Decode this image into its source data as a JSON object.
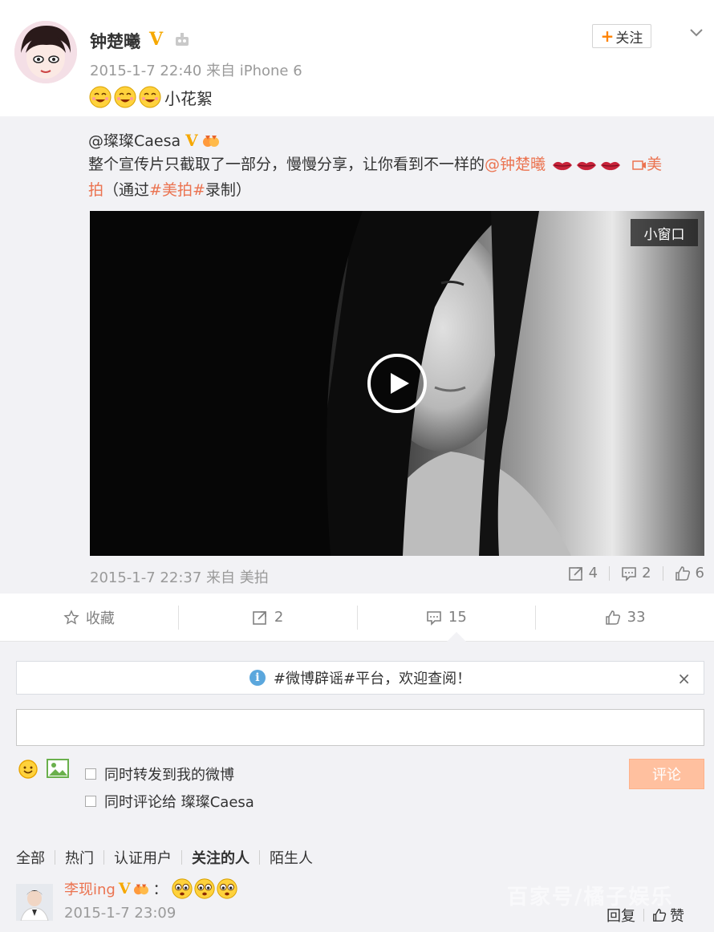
{
  "post": {
    "author": "钟楚曦",
    "meta": "2015-1-7 22:40 来自 iPhone 6",
    "text": "小花絮",
    "emoji_count": 3,
    "follow_label": "关注",
    "follow_plus": "+"
  },
  "repost": {
    "author": "@璨璨Caesa",
    "text_pre": "整个宣传片只截取了一部分，慢慢分享，让你看到不一样的",
    "text_mention": "@钟楚曦",
    "text_link1": "美",
    "text_link2": "拍",
    "text_via_pre": "（通过",
    "text_topic": "#美拍#",
    "text_via_post": "录制）",
    "mini_window": "小窗口",
    "meta": "2015-1-7 22:37 来自 美拍",
    "forwards": "4",
    "comments": "2",
    "likes": "6"
  },
  "action_bar": {
    "favorite": "收藏",
    "forward": "2",
    "comment": "15",
    "like": "33"
  },
  "comment_box": {
    "notice": "#微博辟谣#平台，欢迎查阅！",
    "close": "×",
    "input_value": "",
    "check1": "同时转发到我的微博",
    "check2": "同时评论给 璨璨Caesa",
    "submit": "评论"
  },
  "filters": [
    "全部",
    "热门",
    "认证用户",
    "关注的人",
    "陌生人"
  ],
  "comment": {
    "user": "李现ing",
    "colon": "：",
    "meta": "2015-1-7 23:09",
    "reply": "回复",
    "like": "赞"
  },
  "watermark": "百家号/橘子娱乐",
  "colors": {
    "accent": "#eb7350",
    "vip": "#f6a800",
    "repost_bg": "#f2f2f5"
  },
  "icons": [
    "robot-icon",
    "chevron-down-icon",
    "lips-icon",
    "video-link-icon",
    "play-icon",
    "forward-icon",
    "comment-icon",
    "like-icon",
    "star-icon",
    "info-icon",
    "smile-icon",
    "image-icon"
  ]
}
